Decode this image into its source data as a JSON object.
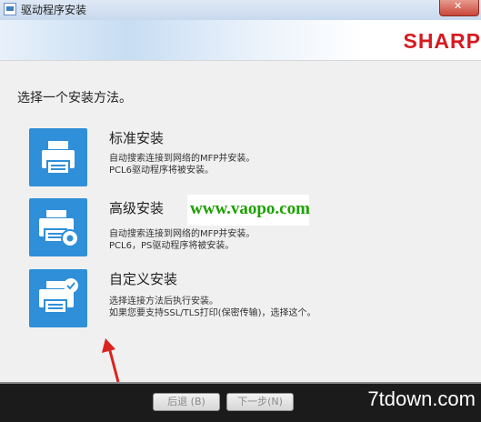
{
  "window": {
    "title": "驱动程序安装",
    "brand": "SHARP"
  },
  "heading": "选择一个安装方法。",
  "options": [
    {
      "title": "标准安装",
      "lines": [
        "自动搜索连接到网络的MFP并安装。",
        "PCL6驱动程序将被安装。"
      ]
    },
    {
      "title": "高级安装",
      "lines": [
        "自动搜索连接到网络的MFP并安装。",
        "PCL6，PS驱动程序将被安装。"
      ]
    },
    {
      "title": "自定义安装",
      "lines": [
        "选择连接方法后执行安装。",
        "如果您要支持SSL/TLS打印(保密传输)，选择这个。"
      ]
    }
  ],
  "watermark": "www.vaopo.com",
  "footer": {
    "back_label": "后退 (B)",
    "next_label": "下一步(N)",
    "site_mark": "7tdown.com"
  },
  "colors": {
    "accent": "#2f8fd8",
    "brand": "#d71920",
    "arrow": "#d9231f"
  }
}
